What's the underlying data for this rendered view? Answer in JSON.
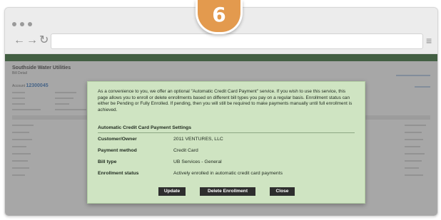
{
  "step_badge": "6",
  "browser": {
    "nav_back": "←",
    "nav_forward": "→",
    "nav_reload": "↻",
    "menu_icon": "≡"
  },
  "page": {
    "title": "Southside Water Utilities",
    "subtitle": "Bill Detail",
    "account_label": "Account",
    "account_number": "12300045"
  },
  "modal": {
    "intro_text": "As a convenience to you, we offer an optional \"Automatic Credit Card Payment\" service. If you wish to use this service, this page allows you to enroll or delete enrollments based on different bill types you pay on a regular basis. Enrollment status can either be Pending or Fully Enrolled. If pending, then you will still be required to make payments manually until full enrollment is achieved.",
    "section_title": "Automatic Credit Card Payment Settings",
    "rows": [
      {
        "label": "Customer/Owner",
        "value": "2011 VENTURES, LLC"
      },
      {
        "label": "Payment method",
        "value": "Credit Card"
      },
      {
        "label": "Bill type",
        "value": "UB Services - General"
      },
      {
        "label": "Enrollment status",
        "value": "Actively enrolled in automatic credit card payments"
      }
    ],
    "buttons": {
      "update": "Update",
      "delete": "Delete Enrollment",
      "close": "Close"
    }
  }
}
